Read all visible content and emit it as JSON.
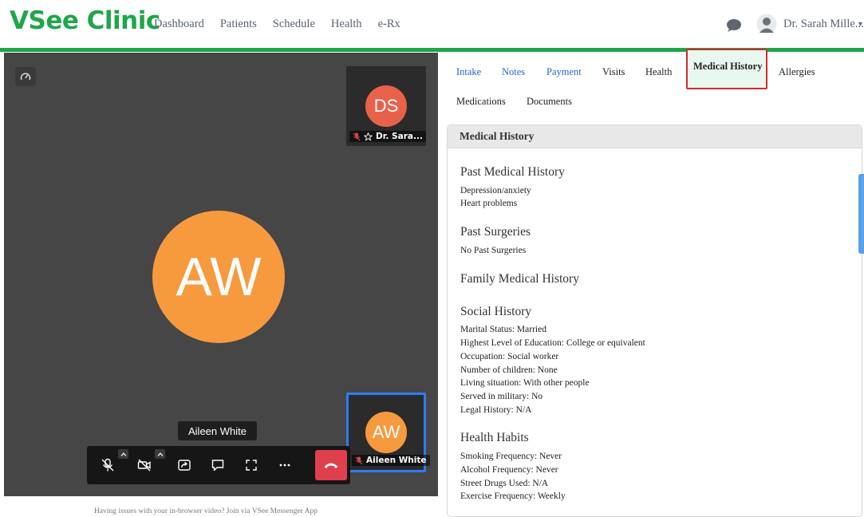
{
  "app": {
    "logo": "VSee Clinic"
  },
  "nav": {
    "items": [
      "Dashboard",
      "Patients",
      "Schedule",
      "Health",
      "e-Rx"
    ]
  },
  "user": {
    "name": "Dr. Sarah Mille...",
    "icons": [
      "chat-bubble-icon",
      "user-avatar-icon",
      "chevron-down-icon"
    ]
  },
  "video": {
    "main_initials": "AW",
    "self_tile": {
      "initials": "DS",
      "label": "Dr. Sara..."
    },
    "patient_tile": {
      "initials": "AW",
      "label": "Aileen White"
    },
    "name_tooltip": "Aileen White",
    "controls": [
      "mic-muted-icon",
      "camera-off-icon",
      "share-screen-icon",
      "chat-icon",
      "fullscreen-icon",
      "more-icon",
      "hang-up-icon"
    ],
    "help_text": "Having issues with your in-browser video? Join via VSee Messenger App"
  },
  "tabs": {
    "row1": [
      "Intake",
      "Notes",
      "Payment",
      "Visits",
      "Health"
    ],
    "active": "Medical History",
    "allergies": "Allergies",
    "row2": [
      "Medications",
      "Documents"
    ]
  },
  "medical_history": {
    "header": "Medical History",
    "past_medical": {
      "title": "Past Medical History",
      "items": [
        "Depression/anxiety",
        "Heart problems"
      ]
    },
    "past_surgeries": {
      "title": "Past Surgeries",
      "items": [
        "No Past Surgeries"
      ]
    },
    "family": {
      "title": "Family Medical History"
    },
    "social": {
      "title": "Social History",
      "items": [
        "Marital Status: Married",
        "Highest Level of Education: College or equivalent",
        "Occupation: Social worker",
        "Number of children: None",
        "Living situation: With other people",
        "Served in military: No",
        "Legal History: N/A"
      ]
    },
    "habits": {
      "title": "Health Habits",
      "items": [
        "Smoking Frequency: Never",
        "Alcohol Frequency: Never",
        "Street Drugs Used: N/A",
        "Exercise Frequency: Weekly"
      ]
    }
  },
  "colors": {
    "brand": "#1fa64a",
    "link": "#2366d1",
    "active_border": "#d42b2b",
    "hangup": "#e0404e",
    "avatar_orange": "#f79a3e",
    "avatar_ds": "#e8624a"
  }
}
